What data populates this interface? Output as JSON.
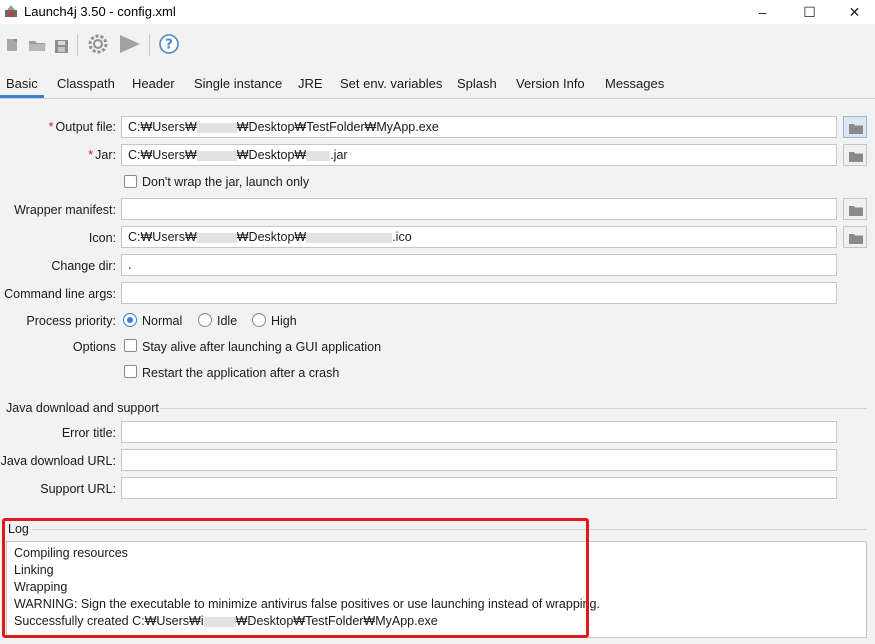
{
  "window": {
    "title": "Launch4j 3.50 - config.xml",
    "controls": {
      "minimize": "–",
      "maximize": "☐",
      "close": "✕"
    }
  },
  "toolbar": {
    "buttons": [
      "new-icon",
      "open-icon",
      "save-icon",
      "build-icon",
      "run-icon",
      "help-icon"
    ]
  },
  "tabs": [
    "Basic",
    "Classpath",
    "Header",
    "Single instance",
    "JRE",
    "Set env. variables",
    "Splash",
    "Version Info",
    "Messages"
  ],
  "active_tab": "Basic",
  "form": {
    "required_mark": "*",
    "output_file": {
      "label": "Output file:",
      "prefix": "C:₩Users₩",
      "suffix": "₩Desktop₩TestFolder₩MyApp.exe"
    },
    "jar": {
      "label": "Jar:",
      "prefix": "C:₩Users₩",
      "middle": "₩Desktop₩",
      "suffix": ".jar"
    },
    "dont_wrap": {
      "label": "Don't wrap the jar, launch only",
      "checked": false
    },
    "wrapper_manifest": {
      "label": "Wrapper manifest:",
      "value": ""
    },
    "icon": {
      "label": "Icon:",
      "prefix": "C:₩Users₩",
      "middle": "₩Desktop₩",
      "suffix": ".ico"
    },
    "change_dir": {
      "label": "Change dir:",
      "value": "."
    },
    "command_line_args": {
      "label": "Command line args:",
      "value": ""
    },
    "process_priority": {
      "label": "Process priority:",
      "options": [
        "Normal",
        "Idle",
        "High"
      ],
      "selected": "Normal"
    },
    "options": {
      "label": "Options",
      "stay_alive": {
        "label": "Stay alive after launching a GUI application",
        "checked": false
      },
      "restart": {
        "label": "Restart the application after a crash",
        "checked": false
      }
    }
  },
  "java_download": {
    "title": "Java download and support",
    "error_title": {
      "label": "Error title:",
      "value": ""
    },
    "download_url": {
      "label": "Java download URL:",
      "value": ""
    },
    "support_url": {
      "label": "Support URL:",
      "value": ""
    }
  },
  "log": {
    "title": "Log",
    "lines": [
      "Compiling resources",
      "Linking",
      "Wrapping",
      "WARNING: Sign the executable to minimize antivirus false positives or use launching instead of wrapping."
    ],
    "last_line": {
      "prefix": "Successfully created C:₩Users₩i",
      "suffix": "₩Desktop₩TestFolder₩MyApp.exe"
    }
  },
  "colors": {
    "accent": "#3b7fd0",
    "required": "#d41a1a",
    "highlight": "#e0191e"
  }
}
